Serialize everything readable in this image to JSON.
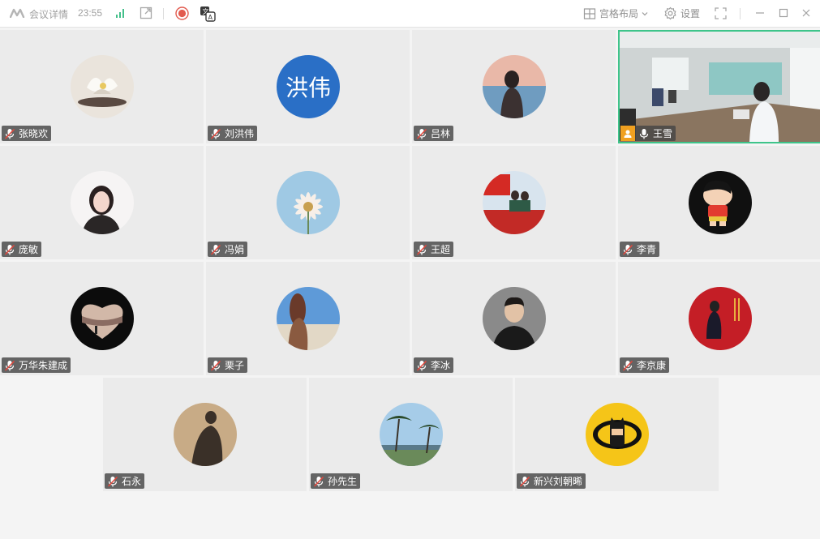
{
  "toolbar": {
    "meeting_info": "会议详情",
    "time": "23:55",
    "layout_label": "宫格布局",
    "settings_label": "设置"
  },
  "participants": [
    {
      "name": "张晓欢"
    },
    {
      "avatar_text": "洪伟",
      "name": "刘洪伟"
    },
    {
      "name": "吕林"
    },
    {
      "name": "王雪"
    },
    {
      "name": "庞敏"
    },
    {
      "name": "冯娟"
    },
    {
      "name": "王超"
    },
    {
      "name": "李青"
    },
    {
      "name": "万华朱建成"
    },
    {
      "name": "栗子"
    },
    {
      "name": "李冰"
    },
    {
      "name": "李京康"
    },
    {
      "name": "石永"
    },
    {
      "name": "孙先生"
    },
    {
      "name": "新兴刘朝晞"
    }
  ],
  "colors": {
    "active_border": "#3ec48a",
    "host_badge": "#f0a020",
    "tile_bg": "#ebebeb"
  }
}
